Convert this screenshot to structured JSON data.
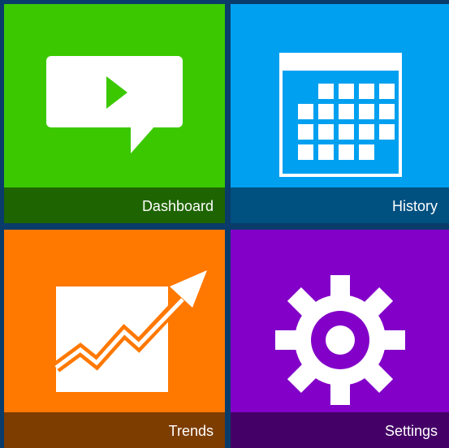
{
  "tiles": [
    {
      "id": "dashboard",
      "label": "Dashboard",
      "icon": "video-chat-bubble-icon",
      "color": "#3cc800",
      "bar_color": "#1e6400"
    },
    {
      "id": "history",
      "label": "History",
      "icon": "calendar-icon",
      "color": "#00a0f0",
      "bar_color": "#005080"
    },
    {
      "id": "trends",
      "label": "Trends",
      "icon": "trend-chart-icon",
      "color": "#ff7800",
      "bar_color": "#7d3c00"
    },
    {
      "id": "settings",
      "label": "Settings",
      "icon": "gear-icon",
      "color": "#8200c8",
      "bar_color": "#440066"
    }
  ],
  "colors": {
    "background": "#0a3c6b",
    "icon": "#ffffff"
  }
}
